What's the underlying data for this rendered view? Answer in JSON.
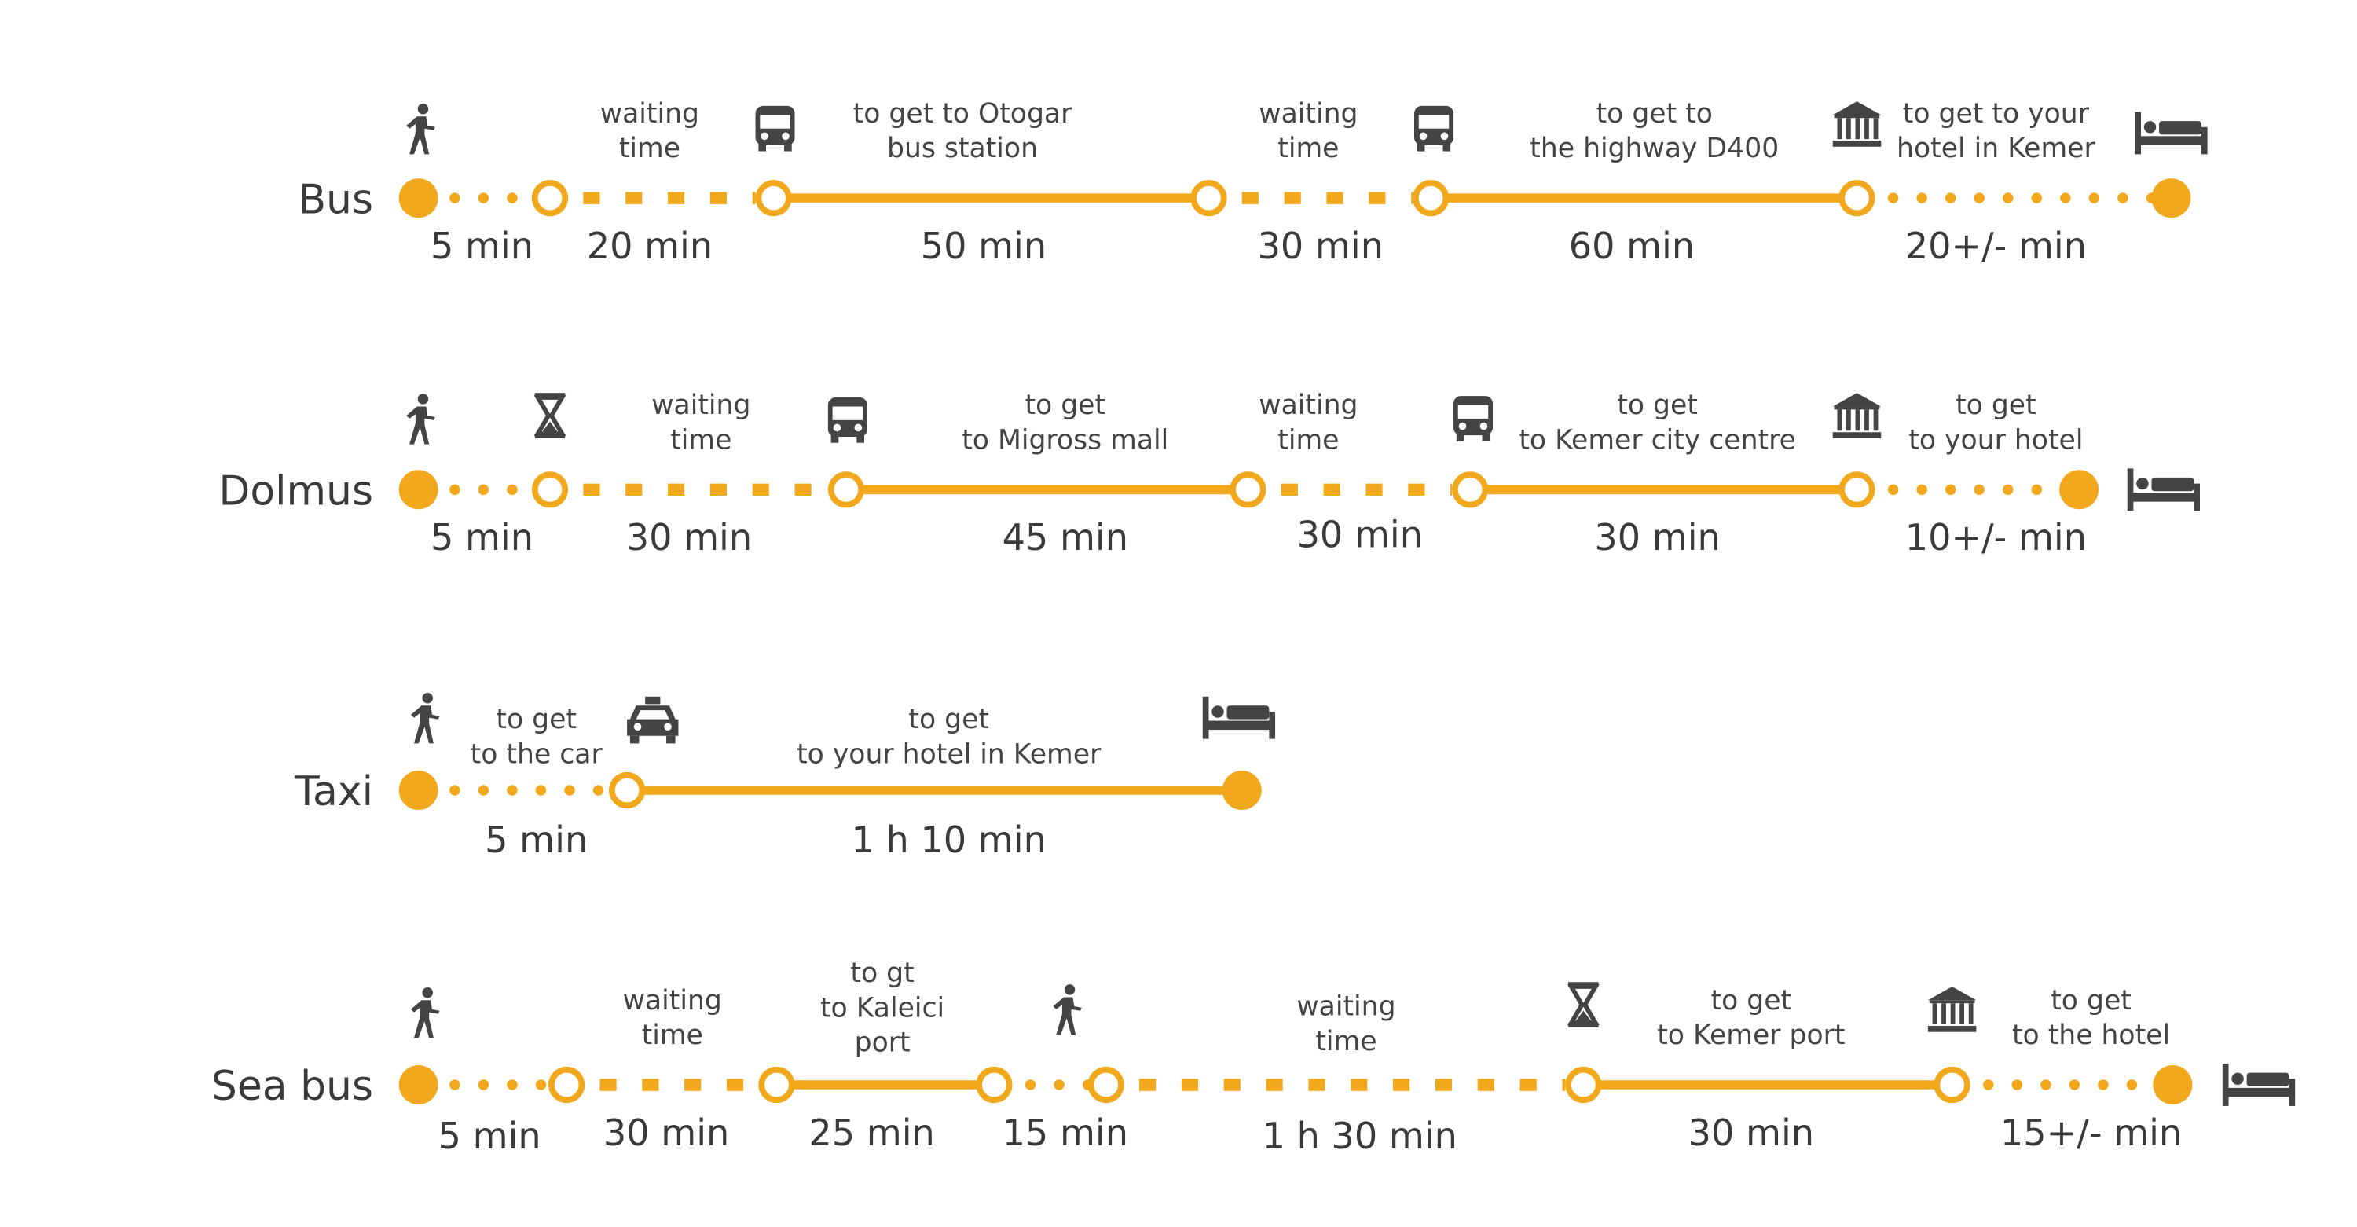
{
  "colors": {
    "accent": "#F2A81D",
    "text": "#444444",
    "icon": "#444444"
  },
  "routes": [
    {
      "name": "Bus",
      "segments": [
        {
          "style": "dotted",
          "label": [],
          "duration": "5 min"
        },
        {
          "style": "dashed",
          "label": [
            "waiting",
            "time"
          ],
          "duration": "20 min"
        },
        {
          "style": "solid",
          "label": [
            "to get to Otogar",
            "bus station"
          ],
          "duration": "50 min"
        },
        {
          "style": "dashed",
          "label": [
            "waiting",
            "time"
          ],
          "duration": "30 min"
        },
        {
          "style": "solid",
          "label": [
            "to get to",
            "the highway D400"
          ],
          "duration": "60 min"
        },
        {
          "style": "dotted",
          "label": [
            "to get to your",
            "hotel in Kemer"
          ],
          "duration": "20+/- min"
        }
      ],
      "icons": [
        "walk-icon",
        "bus-icon",
        "bus-icon",
        "museum-icon",
        "bed-icon"
      ]
    },
    {
      "name": "Dolmus",
      "segments": [
        {
          "style": "dotted",
          "label": [],
          "duration": "5 min"
        },
        {
          "style": "dashed",
          "label": [
            "waiting",
            "time"
          ],
          "duration": "30 min"
        },
        {
          "style": "solid",
          "label": [
            "to get",
            "to Migross mall"
          ],
          "duration": "45 min"
        },
        {
          "style": "dashed",
          "label": [
            "waiting",
            "time"
          ],
          "duration": "30 min"
        },
        {
          "style": "solid",
          "label": [
            "to get",
            "to Kemer city centre"
          ],
          "duration": "30 min"
        },
        {
          "style": "dotted",
          "label": [
            "to get",
            "to your hotel"
          ],
          "duration": "10+/- min"
        }
      ],
      "icons": [
        "walk-icon",
        "hourglass-icon",
        "bus-icon",
        "bus-icon",
        "museum-icon",
        "bed-icon"
      ]
    },
    {
      "name": "Taxi",
      "segments": [
        {
          "style": "dotted",
          "label": [
            "to get",
            "to the car"
          ],
          "duration": "5 min"
        },
        {
          "style": "solid",
          "label": [
            "to get",
            "to your hotel in Kemer"
          ],
          "duration": "1 h 10 min"
        }
      ],
      "icons": [
        "walk-icon",
        "taxi-icon",
        "bed-icon"
      ]
    },
    {
      "name": "Sea bus",
      "segments": [
        {
          "style": "dotted",
          "label": [],
          "duration": "5 min"
        },
        {
          "style": "dashed",
          "label": [
            "waiting",
            "time"
          ],
          "duration": "30 min"
        },
        {
          "style": "solid",
          "label": [
            "to gt",
            "to Kaleici",
            "port"
          ],
          "duration": "25 min"
        },
        {
          "style": "dotted",
          "label": [],
          "duration": "15 min"
        },
        {
          "style": "dashed",
          "label": [
            "waiting",
            "time"
          ],
          "duration": "1 h 30 min"
        },
        {
          "style": "solid",
          "label": [
            "to get",
            "to Kemer port"
          ],
          "duration": "30 min"
        },
        {
          "style": "dotted",
          "label": [
            "to get",
            "to the hotel"
          ],
          "duration": "15+/- min"
        }
      ],
      "icons": [
        "walk-icon",
        "walk-icon",
        "hourglass-icon",
        "museum-icon",
        "bed-icon"
      ]
    }
  ]
}
